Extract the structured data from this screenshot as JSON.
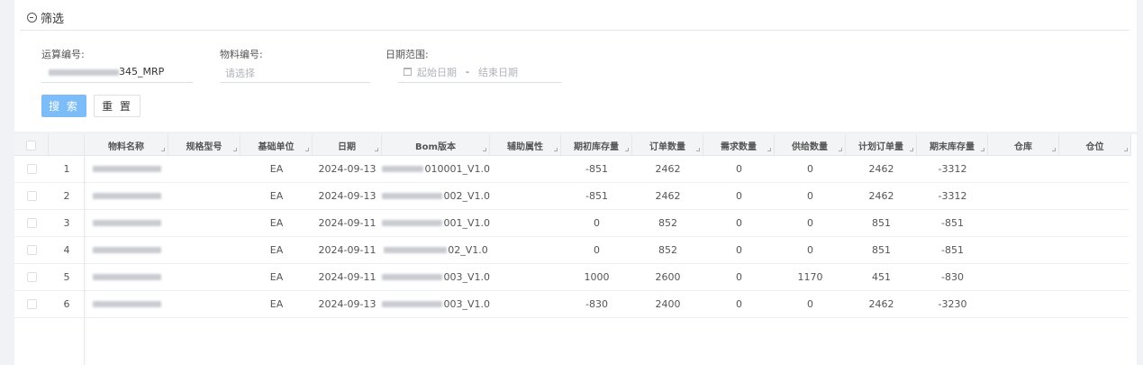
{
  "filter": {
    "title": "筛选",
    "calc_no_label": "运算编号:",
    "calc_no_value_suffix": "345_MRP",
    "material_no_label": "物料编号:",
    "material_no_placeholder": "请选择",
    "date_range_label": "日期范围:",
    "start_placeholder": "起始日期",
    "range_separator": "-",
    "end_placeholder": "结束日期",
    "search_button": "搜 索",
    "reset_button": "重 置"
  },
  "table": {
    "columns": [
      "物料名称",
      "规格型号",
      "基础单位",
      "日期",
      "Bom版本",
      "辅助属性",
      "期初库存量",
      "订单数量",
      "需求数量",
      "供给数量",
      "计划订单量",
      "期末库存量",
      "仓库",
      "仓位"
    ],
    "rows": [
      {
        "index": "1",
        "unit": "EA",
        "date": "2024-09-13",
        "bom_suffix": "010001_V1.0",
        "opening_stock": "-851",
        "order_qty": "2462",
        "demand_qty": "0",
        "supply_qty": "0",
        "planned_qty": "2462",
        "closing_stock": "-3312"
      },
      {
        "index": "2",
        "unit": "EA",
        "date": "2024-09-13",
        "bom_suffix": "002_V1.0",
        "opening_stock": "-851",
        "order_qty": "2462",
        "demand_qty": "0",
        "supply_qty": "0",
        "planned_qty": "2462",
        "closing_stock": "-3312"
      },
      {
        "index": "3",
        "unit": "EA",
        "date": "2024-09-11",
        "bom_suffix": "001_V1.0",
        "opening_stock": "0",
        "order_qty": "852",
        "demand_qty": "0",
        "supply_qty": "0",
        "planned_qty": "851",
        "closing_stock": "-851"
      },
      {
        "index": "4",
        "unit": "EA",
        "date": "2024-09-11",
        "bom_suffix": "02_V1.0",
        "opening_stock": "0",
        "order_qty": "852",
        "demand_qty": "0",
        "supply_qty": "0",
        "planned_qty": "851",
        "closing_stock": "-851"
      },
      {
        "index": "5",
        "unit": "EA",
        "date": "2024-09-11",
        "bom_suffix": "003_V1.0",
        "opening_stock": "1000",
        "order_qty": "2600",
        "demand_qty": "0",
        "supply_qty": "1170",
        "planned_qty": "451",
        "closing_stock": "-830"
      },
      {
        "index": "6",
        "unit": "EA",
        "date": "2024-09-13",
        "bom_suffix": "003_V1.0",
        "opening_stock": "-830",
        "order_qty": "2400",
        "demand_qty": "0",
        "supply_qty": "0",
        "planned_qty": "2462",
        "closing_stock": "-3230"
      }
    ]
  },
  "colors": {
    "primary_button": "#7cbcf8",
    "header_bg": "#f3f4f6",
    "page_bg": "#f0f2f5"
  }
}
